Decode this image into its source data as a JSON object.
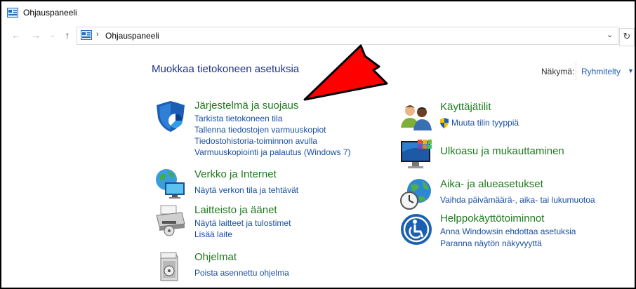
{
  "window": {
    "title": "Ohjauspaneeli"
  },
  "address": {
    "path": "Ohjauspaneeli"
  },
  "main": {
    "heading": "Muokkaa tietokoneen asetuksia",
    "view_label": "Näkymä:",
    "view_value": "Ryhmitelty"
  },
  "categories_left": [
    {
      "title": "Järjestelmä ja suojaus",
      "links": [
        "Tarkista tietokoneen tila",
        "Tallenna tiedostojen varmuuskopiot",
        "Tiedostohistoria-toiminnon avulla",
        "Varmuuskopiointi ja palautus (Windows 7)"
      ]
    },
    {
      "title": "Verkko ja Internet",
      "links": [
        "Näytä verkon tila ja tehtävät"
      ]
    },
    {
      "title": "Laitteisto ja äänet",
      "links": [
        "Näytä laitteet ja tulostimet",
        "Lisää laite"
      ]
    },
    {
      "title": "Ohjelmat",
      "links": [
        "Poista asennettu ohjelma"
      ]
    }
  ],
  "categories_right": [
    {
      "title": "Käyttäjätilit",
      "links": [
        "Muuta tilin tyyppiä"
      ]
    },
    {
      "title": "Ulkoasu ja mukauttaminen",
      "links": []
    },
    {
      "title": "Aika- ja alueasetukset",
      "links": [
        "Vaihda päivämäärä-, aika- tai lukumuotoa"
      ]
    },
    {
      "title": "Helppokäyttötoiminnot",
      "links": [
        "Anna Windowsin ehdottaa asetuksia",
        "Paranna näytön näkyvyyttä"
      ]
    }
  ],
  "colors": {
    "link": "#1a4fa0",
    "category_title": "#1f7a1f",
    "heading": "#1e3287",
    "annotation_arrow": "#ff0000"
  }
}
